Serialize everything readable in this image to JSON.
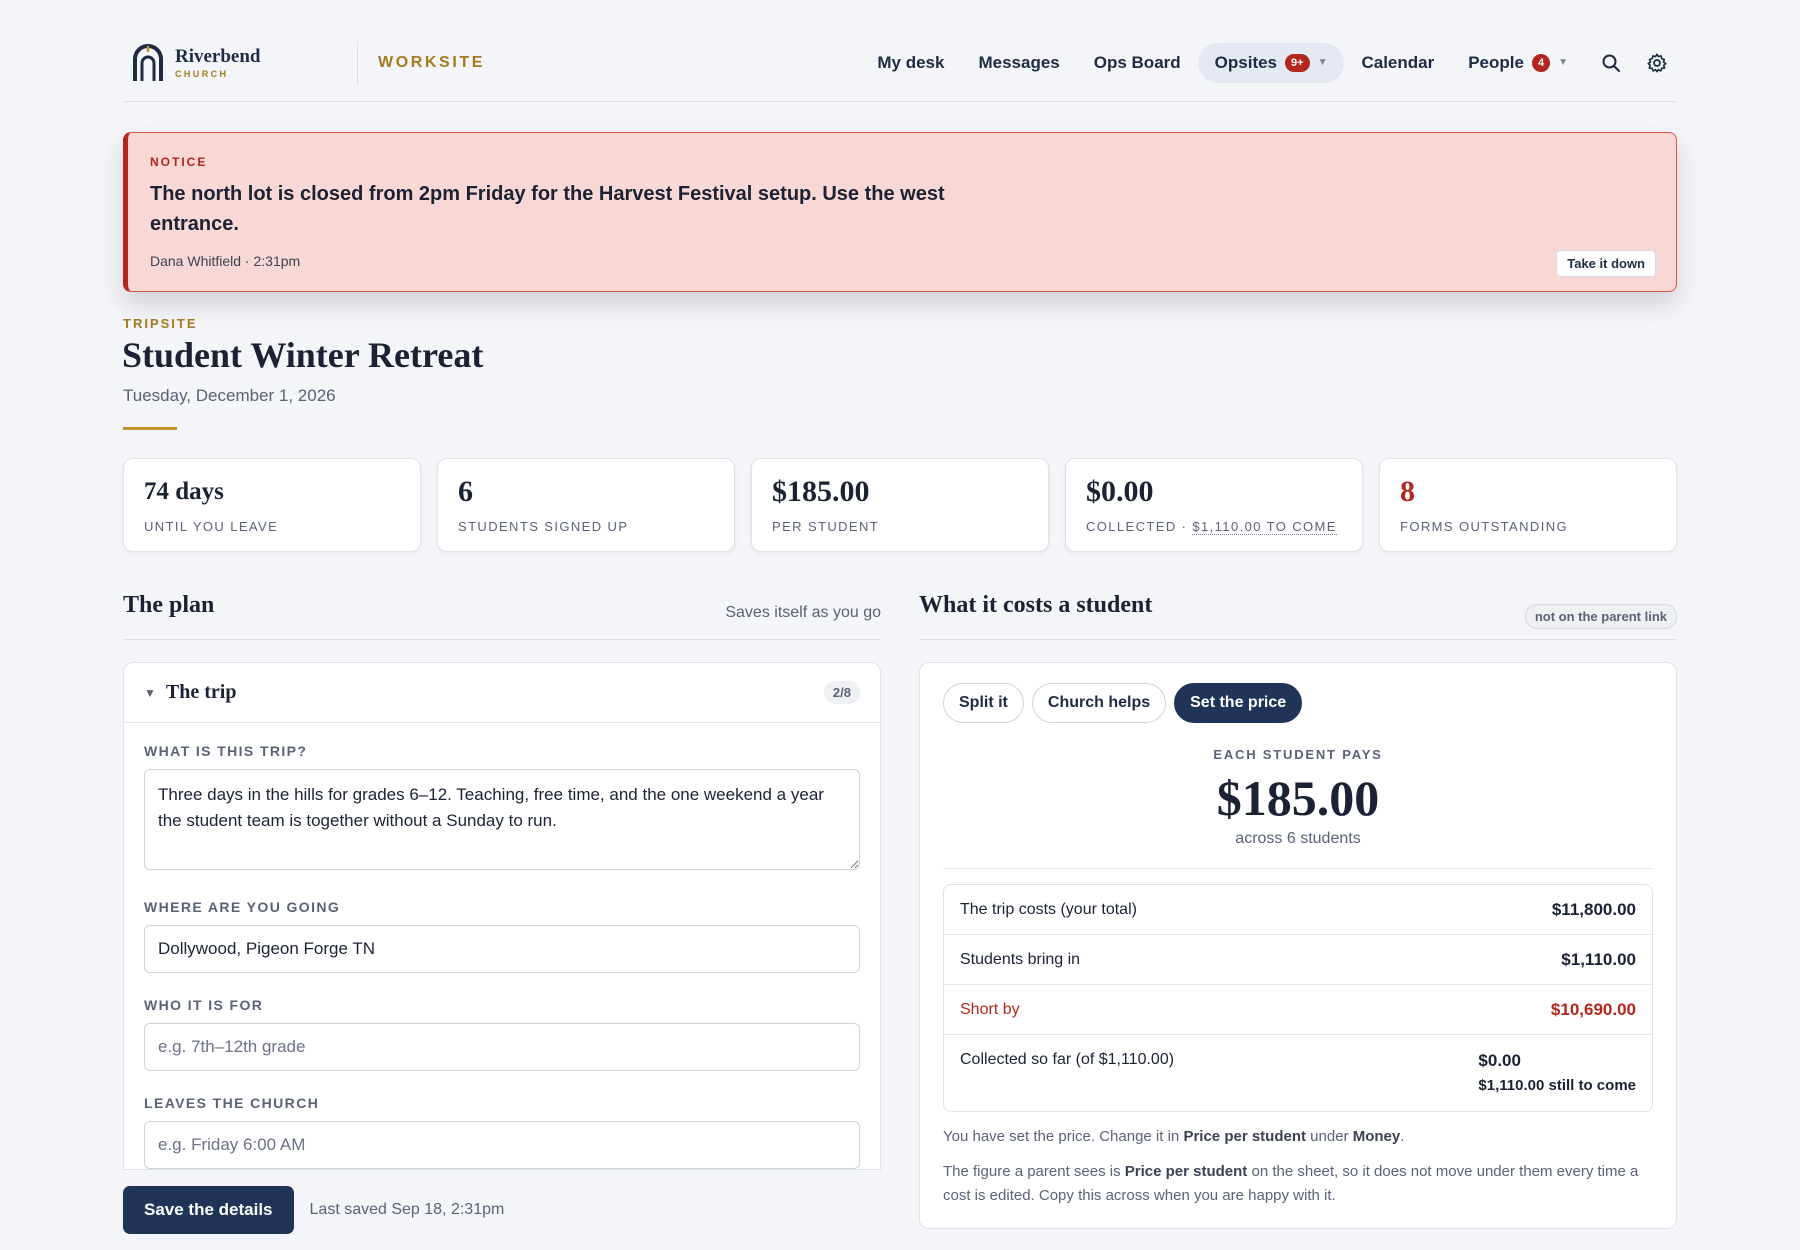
{
  "brand": {
    "name": "Riverbend",
    "sub": "CHURCH",
    "app": "WORKSITE"
  },
  "nav": {
    "items": [
      {
        "label": "My desk"
      },
      {
        "label": "Messages"
      },
      {
        "label": "Ops Board"
      },
      {
        "label": "Opsites",
        "badge": "9+",
        "active": true
      },
      {
        "label": "Calendar"
      },
      {
        "label": "People",
        "badge": "4"
      }
    ],
    "icons": [
      "search-icon",
      "gear-icon"
    ]
  },
  "notice": {
    "kicker": "NOTICE",
    "message": "The north lot is closed from 2pm Friday for the Harvest Festival setup. Use the west entrance.",
    "author": "Dana Whitfield · 2:31pm",
    "action": "Take it down"
  },
  "trip": {
    "kicker": "TRIPSITE",
    "title": "Student Winter Retreat",
    "date": "Tuesday, December 1, 2026"
  },
  "stats": [
    {
      "value": "74 days",
      "label": "UNTIL YOU LEAVE"
    },
    {
      "value": "6",
      "label": "STUDENTS SIGNED UP"
    },
    {
      "value": "$185.00",
      "label": "PER STUDENT"
    },
    {
      "value": "$0.00",
      "label_prefix": "COLLECTED · ",
      "label_link": "$1,110.00 TO COME"
    },
    {
      "value": "8",
      "label": "FORMS OUTSTANDING"
    }
  ],
  "plan": {
    "heading": "The plan",
    "aside": "Saves itself as you go",
    "section_title": "The trip",
    "section_count": "2/8",
    "fields": {
      "what_label": "WHAT IS THIS TRIP?",
      "what_value": "Three days in the hills for grades 6–12. Teaching, free time, and the one weekend a year the student team is together without a Sunday to run.",
      "where_label": "WHERE ARE YOU GOING",
      "where_value": "Dollywood, Pigeon Forge TN",
      "who_label": "WHO IT IS FOR",
      "who_placeholder": "e.g. 7th–12th grade",
      "leaves_label": "LEAVES THE CHURCH",
      "leaves_placeholder": "e.g. Friday 6:00 AM"
    },
    "save_label": "Save the details",
    "last_saved": "Last saved Sep 18, 2:31pm"
  },
  "cost": {
    "heading": "What it costs a student",
    "pill": "not on the parent link",
    "tabs": [
      "Split it",
      "Church helps",
      "Set the price"
    ],
    "active_tab": "Set the price",
    "pays_kicker": "EACH STUDENT PAYS",
    "pays_amount": "$185.00",
    "pays_across": "across 6 students",
    "rows": [
      {
        "label": "The trip costs (your total)",
        "amount": "$11,800.00"
      },
      {
        "label": "Students bring in",
        "amount": "$1,110.00"
      },
      {
        "label": "Short by",
        "amount": "$10,690.00"
      }
    ],
    "collected": {
      "label": "Collected so far (of $1,110.00)",
      "amount": "$0.00",
      "still": "$1,110.00 still to come"
    },
    "note1": {
      "a": "You have set the price. Change it in ",
      "b": "Price per student",
      "c": " under ",
      "d": "Money",
      "e": "."
    },
    "note2": {
      "a": "The figure a parent sees is ",
      "b": "Price per student",
      "c": " on the sheet, so it does not move under them every time a cost is edited. Copy this across when you are happy with it."
    }
  },
  "colors": {
    "accent": "#1f3457",
    "gold": "#a57a1f",
    "danger": "#b3261e",
    "notice_bg": "#f8d8d4"
  }
}
